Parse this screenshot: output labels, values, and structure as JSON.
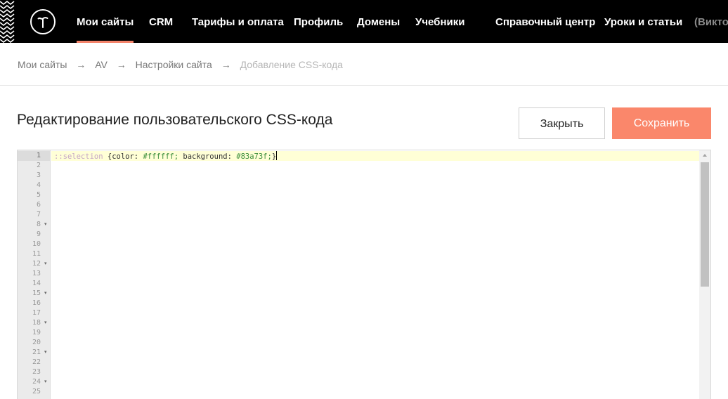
{
  "nav": {
    "items": [
      {
        "label": "Мои сайты",
        "active": true
      },
      {
        "label": "CRM"
      },
      {
        "label": "Тарифы и оплата"
      },
      {
        "label": "Профиль"
      },
      {
        "label": "Домены"
      },
      {
        "label": "Учебники"
      }
    ],
    "right_items": [
      {
        "label": "Справочный центр"
      },
      {
        "label": "Уроки и статьи"
      }
    ],
    "user": "(Виктор"
  },
  "breadcrumb": {
    "items": [
      "Мои сайты",
      "AV",
      "Настройки сайта",
      "Добавление CSS-кода"
    ],
    "separator": "→"
  },
  "page": {
    "title": "Редактирование пользовательского CSS-кода",
    "close_label": "Закрыть",
    "save_label": "Сохранить"
  },
  "editor": {
    "active_line": 1,
    "fold_lines": [
      8,
      12,
      15,
      18,
      21,
      24
    ],
    "line_numbers": [
      "1",
      "2",
      "3",
      "4",
      "5",
      "6",
      "7",
      "8",
      "9",
      "10",
      "11",
      "12",
      "13",
      "14",
      "15",
      "16",
      "17",
      "18",
      "19",
      "20",
      "21",
      "22",
      "23",
      "24",
      "25"
    ],
    "code": {
      "selector": "::selection",
      "open_brace": "{",
      "prop1": "color:",
      "val1": "#ffffff;",
      "prop2": "background:",
      "val2": "#83a73f;",
      "close_brace": "}"
    }
  },
  "colors": {
    "nav_bg": "#000000",
    "accent": "#f4846b",
    "save_button": "#fa876b",
    "active_line_bg": "#ffffd6"
  }
}
